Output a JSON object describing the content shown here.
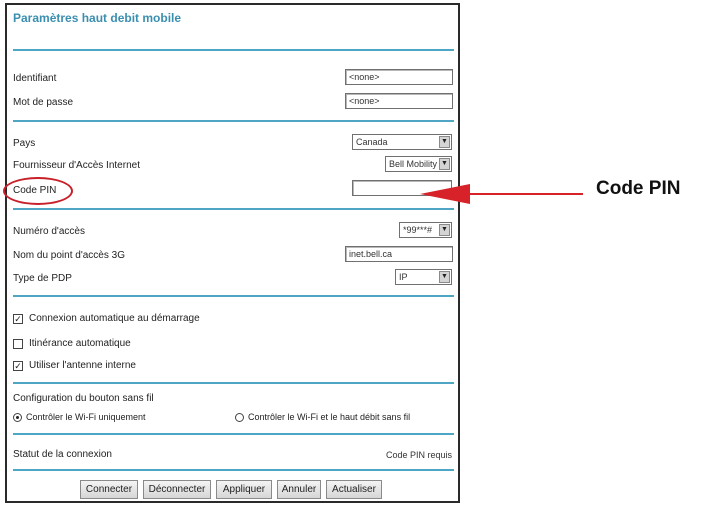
{
  "page": {
    "title": "Paramètres haut debit mobile"
  },
  "credentials": {
    "username_label": "Identifiant",
    "username_value": "<none>",
    "password_label": "Mot de passe",
    "password_value": "<none>"
  },
  "network": {
    "country_label": "Pays",
    "country_value": "Canada",
    "isp_label": "Fournisseur d'Accès Internet",
    "isp_value": "Bell Mobility",
    "pin_label": "Code PIN",
    "pin_value": ""
  },
  "access": {
    "number_label": "Numéro d'accès",
    "number_value": "*99***#",
    "apn_label": "Nom du point d'accès 3G",
    "apn_value": "inet.bell.ca",
    "pdp_label": "Type de PDP",
    "pdp_value": "IP"
  },
  "options": {
    "auto_connect_label": "Connexion automatique au démarrage",
    "auto_connect_checked": true,
    "roaming_label": "Itinérance automatique",
    "roaming_checked": false,
    "internal_antenna_label": "Utiliser l'antenne interne",
    "internal_antenna_checked": true
  },
  "wireless_button": {
    "section_label": "Configuration du bouton sans fil",
    "option_wifi_only": "Contrôler le Wi-Fi uniquement",
    "option_wifi_and_mobile": "Contrôler le Wi-Fi et le haut débit sans fil",
    "selected": "wifi_only"
  },
  "status": {
    "label": "Statut de la connexion",
    "value": "Code PIN requis"
  },
  "buttons": {
    "connect": "Connecter",
    "disconnect": "Déconnecter",
    "apply": "Appliquer",
    "cancel": "Annuler",
    "refresh": "Actualiser"
  },
  "annotation": {
    "callout_text": "Code PIN"
  },
  "colors": {
    "title": "#3a8fb0",
    "divider": "#4fa6c4",
    "highlight": "#d8222a"
  }
}
